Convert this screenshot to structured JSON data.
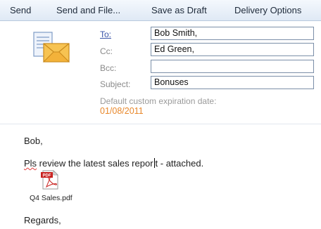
{
  "toolbar": {
    "send": "Send",
    "send_and_file": "Send and File...",
    "save_as_draft": "Save as Draft",
    "delivery_options": "Delivery Options"
  },
  "header": {
    "to_label": "To:",
    "to_value": "Bob Smith,",
    "cc_label": "Cc:",
    "cc_value": "Ed Green,",
    "bcc_label": "Bcc:",
    "bcc_value": "",
    "subject_label": "Subject:",
    "subject_value": "Bonuses",
    "expiration_label": "Default custom expiration date:",
    "expiration_date": "01/08/2011"
  },
  "message": {
    "greeting": "Bob,",
    "line1_misspelled": "Pls",
    "line1_before_caret": " review the latest sales repor",
    "line1_after_caret": "t - attached.",
    "closing": "Regards,"
  },
  "attachment": {
    "icon_label": "PDF",
    "file_name": "Q4 Sales.pdf"
  },
  "icons": [
    "envelope-icon",
    "pdf-file-icon"
  ],
  "colors": {
    "accent_green": "#19e01f",
    "link_blue": "#3a54a8",
    "date_orange": "#e8872a"
  }
}
